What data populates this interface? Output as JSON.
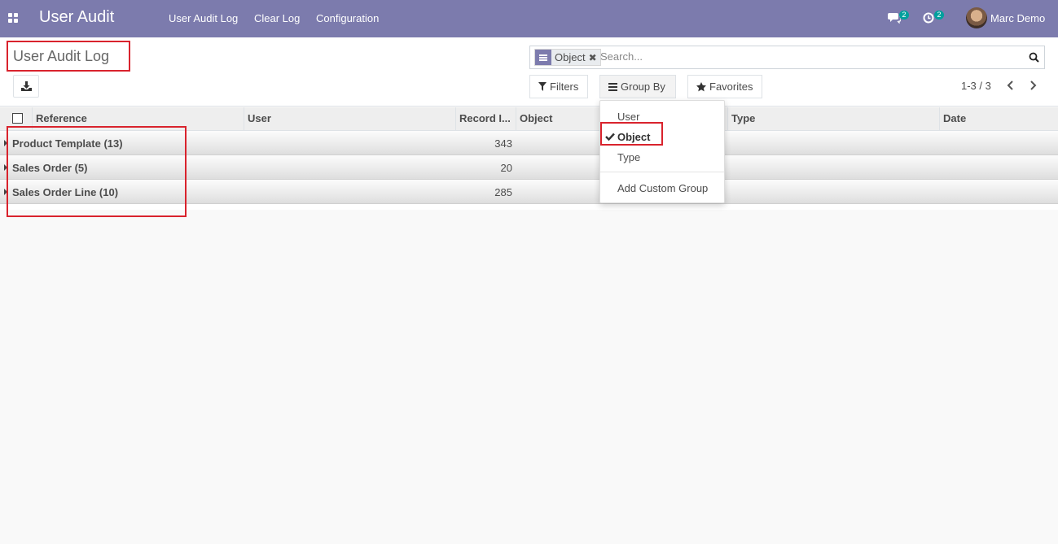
{
  "navbar": {
    "brand": "User Audit",
    "menu": [
      "User Audit Log",
      "Clear Log",
      "Configuration"
    ],
    "messages_count": "2",
    "activities_count": "2",
    "user_name": "Marc Demo",
    "bg_color": "#7c7bad"
  },
  "page": {
    "title": "User Audit Log"
  },
  "search": {
    "facet_label": "Object",
    "placeholder": "Search..."
  },
  "toolbar": {
    "filters_label": "Filters",
    "group_by_label": "Group By",
    "favorites_label": "Favorites",
    "pager": "1-3 / 3"
  },
  "group_by_menu": {
    "items": [
      "User",
      "Object",
      "Type"
    ],
    "selected": "Object",
    "custom_label": "Add Custom Group"
  },
  "table": {
    "columns": [
      "Reference",
      "User",
      "Record I...",
      "Object",
      "Type",
      "Date"
    ],
    "groups": [
      {
        "name": "Product Template (13)",
        "value": "343"
      },
      {
        "name": "Sales Order (5)",
        "value": "20"
      },
      {
        "name": "Sales Order Line (10)",
        "value": "285"
      }
    ]
  },
  "colors": {
    "highlight_box": "#d9232d",
    "accent": "#7c7bad",
    "badge": "#00a09d"
  }
}
